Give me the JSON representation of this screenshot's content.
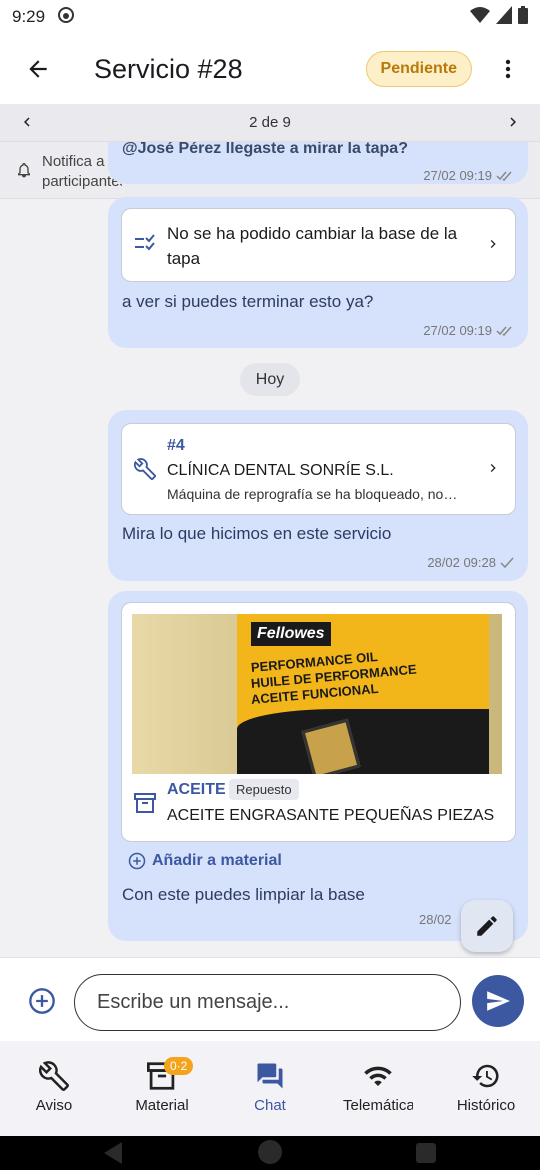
{
  "status_bar": {
    "time": "9:29"
  },
  "app_bar": {
    "title": "Servicio #28",
    "status_badge": "Pendiente"
  },
  "pager": {
    "label": "2 de 9"
  },
  "notify": {
    "text_line1": "Notifica a",
    "text_line2": "participantes"
  },
  "messages": [
    {
      "partial_text": "@José Pérez llegaste a mirar la tapa?",
      "time": "27/02 09:19"
    },
    {
      "card_text": "No se ha podido cambiar la base de la tapa",
      "text": "a ver si puedes terminar esto ya?",
      "time": "27/02 09:19"
    },
    {
      "card_number": "#4",
      "card_client": "CLÍNICA DENTAL SONRÍE S.L.",
      "card_desc": "Máquina de reprografía se ha bloqueado, no…",
      "text": "Mira lo que hicimos en este servicio",
      "time": "28/02 09:28"
    },
    {
      "product_category": "ACEITE",
      "product_chip": "Repuesto",
      "product_name": "ACEITE ENGRASANTE PEQUEÑAS PIEZAS",
      "add_material": "Añadir a material",
      "text": "Con este puedes limpiar la base",
      "time": "28/02"
    }
  ],
  "product_image": {
    "brand": "Fellowes",
    "line1": "PERFORMANCE OIL",
    "line2": "HUILE DE PERFORMANCE",
    "line3": "ACEITE FUNCIONAL"
  },
  "day_separator": "Hoy",
  "composer": {
    "placeholder": "Escribe un mensaje..."
  },
  "bottom_nav": {
    "items": [
      {
        "label": "Aviso"
      },
      {
        "label": "Material",
        "badge": "0·2"
      },
      {
        "label": "Chat"
      },
      {
        "label": "Telemática"
      },
      {
        "label": "Histórico"
      }
    ]
  },
  "colors": {
    "accent": "#3c58a0",
    "bubble": "#d6e2fb",
    "badge_bg": "#fdefc7",
    "badge_text": "#b9790a",
    "nav_badge": "#f4a31c"
  }
}
